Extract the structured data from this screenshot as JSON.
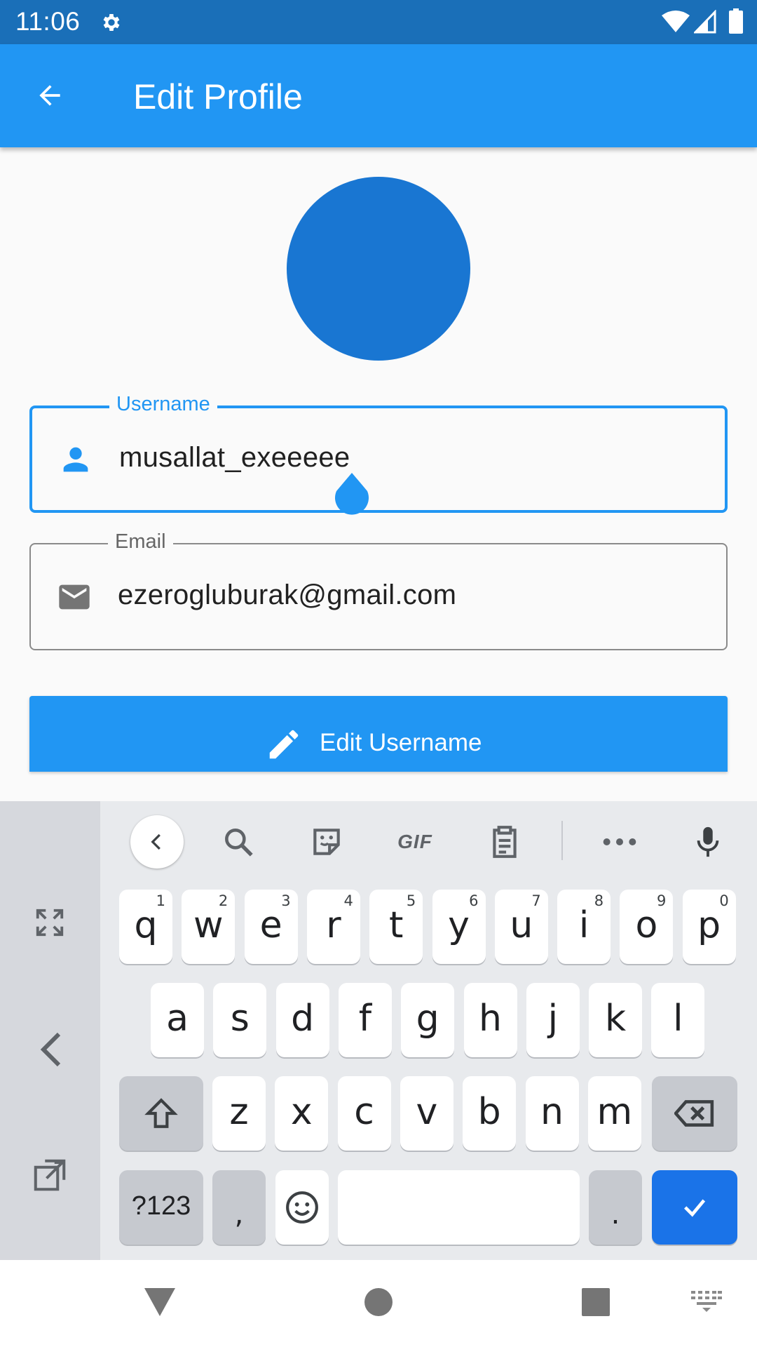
{
  "status_bar": {
    "time": "11:06",
    "icons": [
      "settings-gear-icon",
      "wifi-icon",
      "cell-signal-icon",
      "battery-icon"
    ]
  },
  "app_bar": {
    "title": "Edit Profile",
    "back_icon": "arrow-back-icon",
    "color": "#2196f3"
  },
  "avatar": {
    "color": "#1976d2"
  },
  "username_field": {
    "label": "Username",
    "value": "musallat_exeeeee",
    "icon": "person-icon",
    "focused": true
  },
  "email_field": {
    "label": "Email",
    "value": "ezerogluburak@gmail.com",
    "icon": "mail-icon"
  },
  "edit_button": {
    "label": "Edit Username",
    "icon": "pencil-icon"
  },
  "keyboard": {
    "toolbar": [
      "chevron-left-icon",
      "search-icon",
      "sticker-icon",
      "gif-icon",
      "clipboard-icon",
      "more-icon",
      "microphone-icon"
    ],
    "gif_label": "GIF",
    "side": [
      "expand-icon",
      "chevron-left-icon",
      "float-icon"
    ],
    "row1": [
      {
        "ch": "q",
        "hint": "1"
      },
      {
        "ch": "w",
        "hint": "2"
      },
      {
        "ch": "e",
        "hint": "3"
      },
      {
        "ch": "r",
        "hint": "4"
      },
      {
        "ch": "t",
        "hint": "5"
      },
      {
        "ch": "y",
        "hint": "6"
      },
      {
        "ch": "u",
        "hint": "7"
      },
      {
        "ch": "i",
        "hint": "8"
      },
      {
        "ch": "o",
        "hint": "9"
      },
      {
        "ch": "p",
        "hint": "0"
      }
    ],
    "row2": [
      "a",
      "s",
      "d",
      "f",
      "g",
      "h",
      "j",
      "k",
      "l"
    ],
    "row3": [
      "z",
      "x",
      "c",
      "v",
      "b",
      "n",
      "m"
    ],
    "symbols_label": "?123",
    "comma": ",",
    "period": ".",
    "accent": "#1a73e8"
  },
  "nav_bar": [
    "back-triangle-icon",
    "home-circle-icon",
    "recents-square-icon",
    "keyboard-switch-icon"
  ]
}
